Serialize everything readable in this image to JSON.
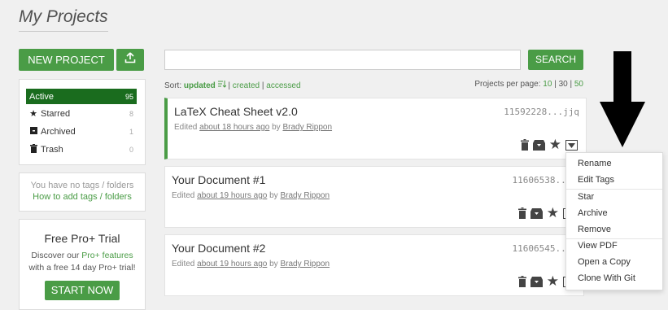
{
  "page": {
    "title": "My Projects"
  },
  "actions": {
    "new_project_label": "NEW PROJECT",
    "upload_icon": "upload-icon"
  },
  "filters": [
    {
      "icon": "",
      "label": "Active",
      "count": "95",
      "active": true
    },
    {
      "icon": "star-icon",
      "label": "Starred",
      "count": "8"
    },
    {
      "icon": "archive-icon",
      "label": "Archived",
      "count": "1"
    },
    {
      "icon": "trash-icon",
      "label": "Trash",
      "count": "0"
    }
  ],
  "tags": {
    "empty_text": "You have no tags / folders",
    "help_link": "How to add tags / folders"
  },
  "promo": {
    "title": "Free Pro+ Trial",
    "text_before": "Discover our ",
    "link": "Pro+ features",
    "text_after": "with a free 14 day Pro+ trial!",
    "button": "START NOW"
  },
  "search": {
    "value": "",
    "placeholder": "",
    "button": "SEARCH"
  },
  "sort": {
    "label": "Sort:",
    "updated": "updated",
    "sep1": "|",
    "created": "created",
    "sep2": "|",
    "accessed": "accessed"
  },
  "per_page": {
    "label": "Projects per page:",
    "opt1": "10",
    "sep1": "|",
    "opt2": "30",
    "sep2": "|",
    "opt3": "50"
  },
  "projects": [
    {
      "title": "LaTeX Cheat Sheet v2.0",
      "edited_prefix": "Edited",
      "time": "about 18 hours ago",
      "by": "by",
      "author": "Brady Rippon",
      "id": "11592228...jjq"
    },
    {
      "title": "Your Document #1",
      "edited_prefix": "Edited",
      "time": "about 19 hours ago",
      "by": "by",
      "author": "Brady Rippon",
      "id": "11606538...x"
    },
    {
      "title": "Your Document #2",
      "edited_prefix": "Edited",
      "time": "about 19 hours ago",
      "by": "by",
      "author": "Brady Rippon",
      "id": "11606545...d"
    }
  ],
  "menu": [
    "Rename",
    "Edit Tags",
    "Star",
    "Archive",
    "Remove",
    "View PDF",
    "Open a Copy",
    "Clone With Git"
  ],
  "colors": {
    "accent": "#4a9c46",
    "active_filter": "#1a6c1e"
  }
}
